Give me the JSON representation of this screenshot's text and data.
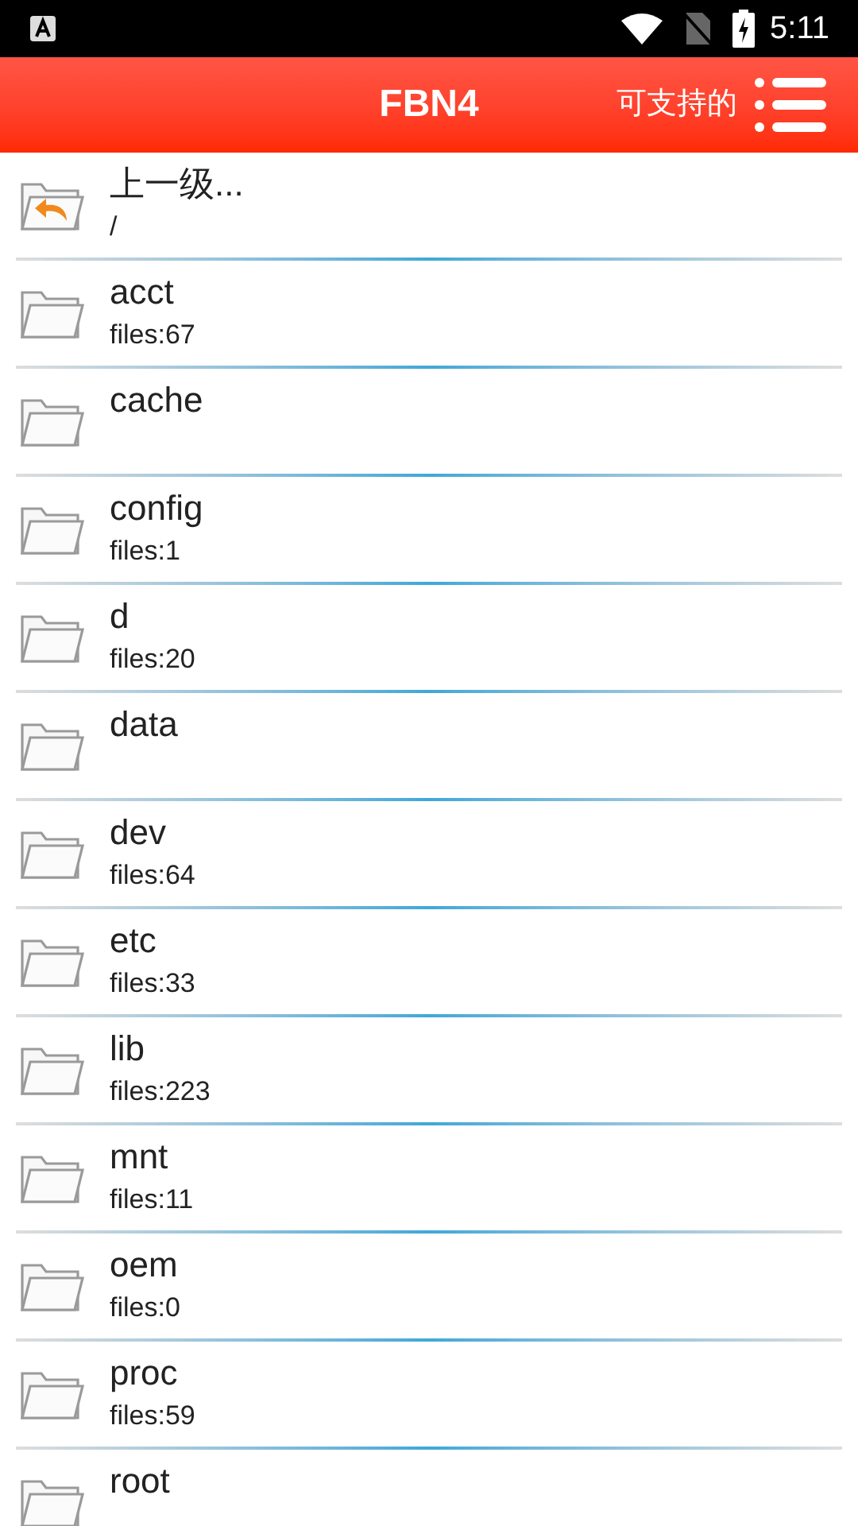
{
  "status_bar": {
    "time": "5:11"
  },
  "header": {
    "title": "FBN4",
    "action": "可支持的"
  },
  "items": [
    {
      "kind": "parent",
      "name": "上一级...",
      "detail": "/"
    },
    {
      "kind": "folder",
      "name": "acct",
      "detail": "files:67"
    },
    {
      "kind": "folder",
      "name": "cache"
    },
    {
      "kind": "folder",
      "name": "config",
      "detail": "files:1"
    },
    {
      "kind": "folder",
      "name": "d",
      "detail": "files:20"
    },
    {
      "kind": "folder",
      "name": "data"
    },
    {
      "kind": "folder",
      "name": "dev",
      "detail": "files:64"
    },
    {
      "kind": "folder",
      "name": "etc",
      "detail": "files:33"
    },
    {
      "kind": "folder",
      "name": "lib",
      "detail": "files:223"
    },
    {
      "kind": "folder",
      "name": "mnt",
      "detail": "files:11"
    },
    {
      "kind": "folder",
      "name": "oem",
      "detail": "files:0"
    },
    {
      "kind": "folder",
      "name": "proc",
      "detail": "files:59"
    },
    {
      "kind": "folder",
      "name": "root"
    }
  ]
}
